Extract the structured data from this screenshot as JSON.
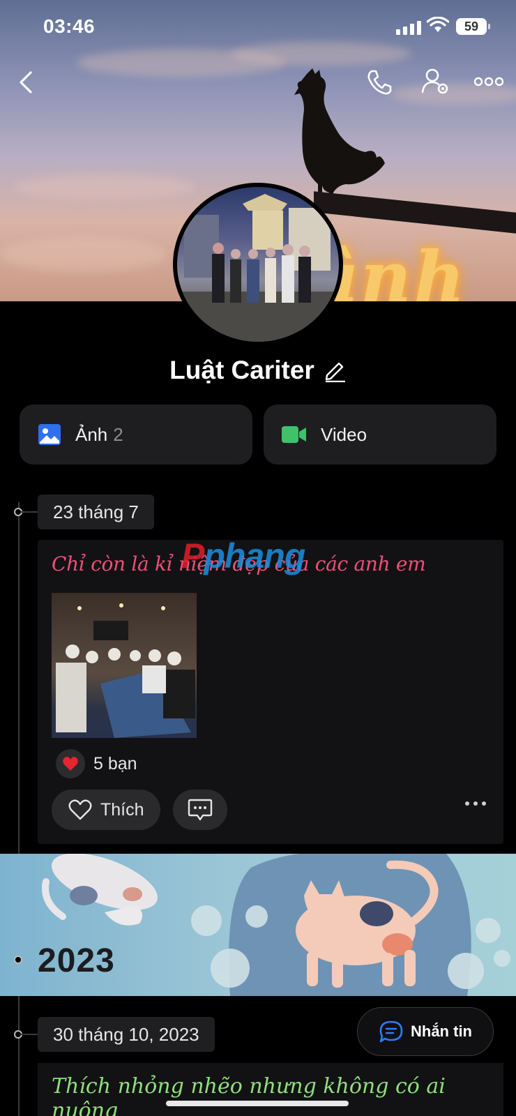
{
  "status_bar": {
    "time": "03:46",
    "battery": "59"
  },
  "profile": {
    "name": "Luật Cariter"
  },
  "media_tabs": {
    "photos_label": "Ảnh",
    "photos_count": "2",
    "video_label": "Video"
  },
  "cover_sign_text": "ình Mi",
  "timeline": {
    "post1": {
      "date": "23 tháng 7",
      "caption": "Chỉ còn là kỉ niệm đẹp của các anh em",
      "reaction_count": "5 bạn",
      "like_label": "Thích"
    },
    "watermark": {
      "prefix": "P",
      "rest": "phang"
    },
    "year_banner": "2023",
    "post2": {
      "date": "30 tháng 10, 2023",
      "caption": "Thích nhỏng nhẽo nhưng không có ai nuông"
    }
  },
  "message_button": {
    "label": "Nhắn tin"
  },
  "colors": {
    "background": "#000000",
    "card": "#121214",
    "caption_pink": "#ef4f7a",
    "caption_green": "#8fe07a",
    "photo_icon_blue": "#2f6ff0",
    "video_icon_green": "#3ec26a"
  }
}
